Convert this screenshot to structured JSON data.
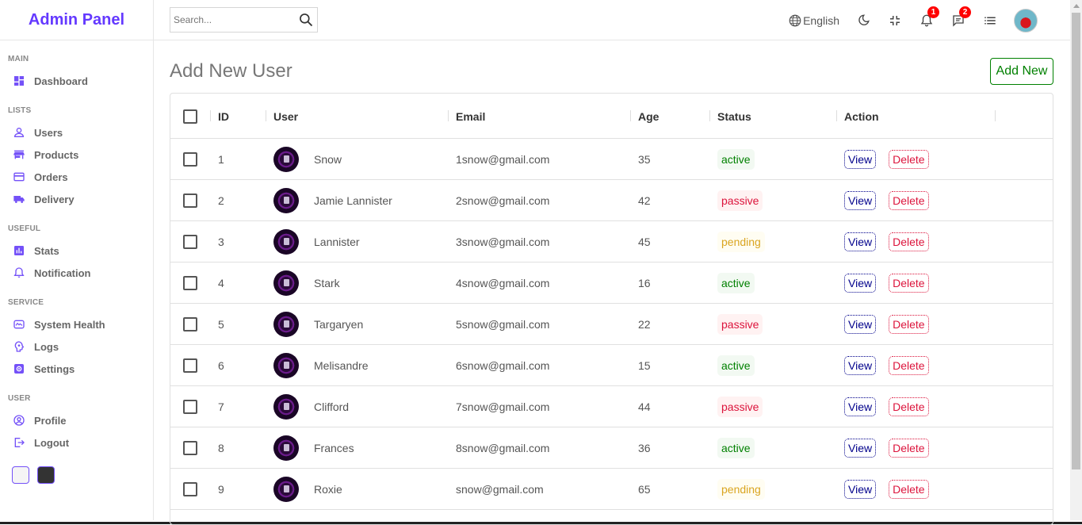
{
  "app": {
    "title": "Admin Panel"
  },
  "sidebar": {
    "sections": [
      {
        "title": "MAIN",
        "items": [
          {
            "label": "Dashboard",
            "icon": "dashboard-icon"
          }
        ]
      },
      {
        "title": "LISTS",
        "items": [
          {
            "label": "Users",
            "icon": "person-icon"
          },
          {
            "label": "Products",
            "icon": "store-icon"
          },
          {
            "label": "Orders",
            "icon": "credit-card-icon"
          },
          {
            "label": "Delivery",
            "icon": "truck-icon"
          }
        ]
      },
      {
        "title": "USEFUL",
        "items": [
          {
            "label": "Stats",
            "icon": "bar-chart-icon"
          },
          {
            "label": "Notification",
            "icon": "bell-icon"
          }
        ]
      },
      {
        "title": "SERVICE",
        "items": [
          {
            "label": "System Health",
            "icon": "health-icon"
          },
          {
            "label": "Logs",
            "icon": "psychology-icon"
          },
          {
            "label": "Settings",
            "icon": "settings-icon"
          }
        ]
      },
      {
        "title": "USER",
        "items": [
          {
            "label": "Profile",
            "icon": "account-circle-icon"
          },
          {
            "label": "Logout",
            "icon": "logout-icon"
          }
        ]
      }
    ],
    "accent_color": "#7451f8"
  },
  "navbar": {
    "search_placeholder": "Search...",
    "language": "English",
    "notifications_count": "1",
    "messages_count": "2"
  },
  "main": {
    "title": "Add New User",
    "add_button": "Add New"
  },
  "table": {
    "columns": [
      "ID",
      "User",
      "Email",
      "Age",
      "Status",
      "Action"
    ],
    "view_label": "View",
    "delete_label": "Delete",
    "rows": [
      {
        "id": "1",
        "user": "Snow",
        "email": "1snow@gmail.com",
        "age": "35",
        "status": "active"
      },
      {
        "id": "2",
        "user": "Jamie Lannister",
        "email": "2snow@gmail.com",
        "age": "42",
        "status": "passive"
      },
      {
        "id": "3",
        "user": "Lannister",
        "email": "3snow@gmail.com",
        "age": "45",
        "status": "pending"
      },
      {
        "id": "4",
        "user": "Stark",
        "email": "4snow@gmail.com",
        "age": "16",
        "status": "active"
      },
      {
        "id": "5",
        "user": "Targaryen",
        "email": "5snow@gmail.com",
        "age": "22",
        "status": "passive"
      },
      {
        "id": "6",
        "user": "Melisandre",
        "email": "6snow@gmail.com",
        "age": "15",
        "status": "active"
      },
      {
        "id": "7",
        "user": "Clifford",
        "email": "7snow@gmail.com",
        "age": "44",
        "status": "passive"
      },
      {
        "id": "8",
        "user": "Frances",
        "email": "8snow@gmail.com",
        "age": "36",
        "status": "active"
      },
      {
        "id": "9",
        "user": "Roxie",
        "email": "snow@gmail.com",
        "age": "65",
        "status": "pending"
      }
    ]
  }
}
